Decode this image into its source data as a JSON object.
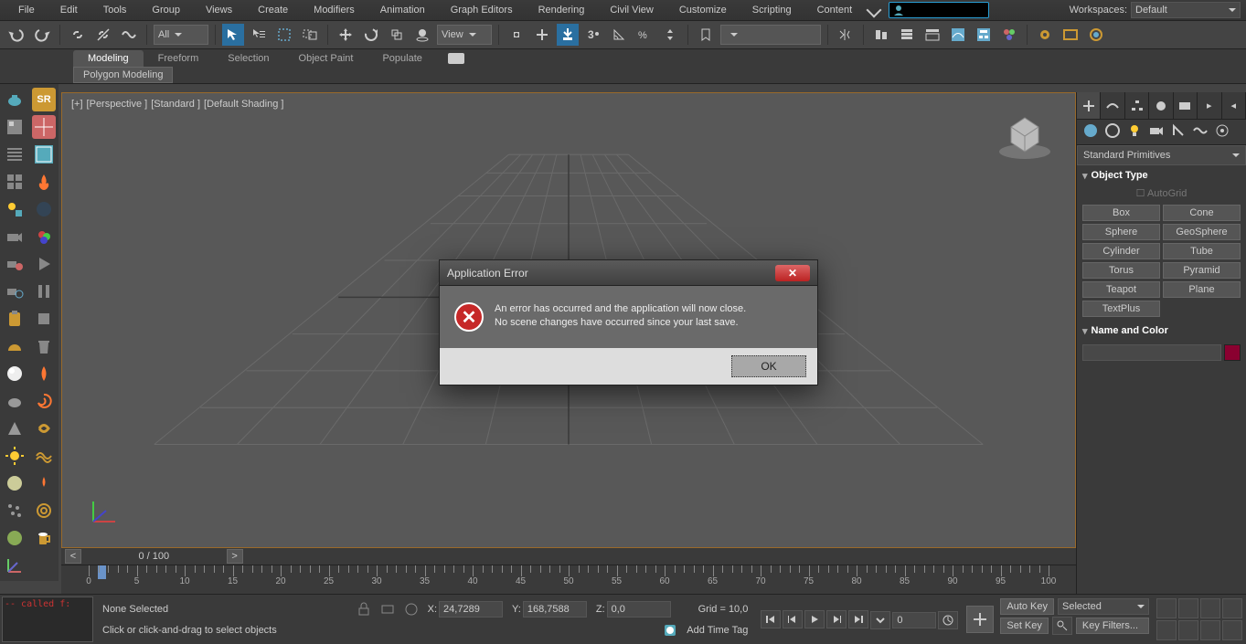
{
  "menu": [
    "File",
    "Edit",
    "Tools",
    "Group",
    "Views",
    "Create",
    "Modifiers",
    "Animation",
    "Graph Editors",
    "Rendering",
    "Civil View",
    "Customize",
    "Scripting",
    "Content"
  ],
  "workspaces": {
    "label": "Workspaces:",
    "value": "Default"
  },
  "toolbar": {
    "drop1": "All",
    "drop2": "View"
  },
  "ribbon": {
    "tabs": [
      "Modeling",
      "Freeform",
      "Selection",
      "Object Paint",
      "Populate"
    ],
    "sub": "Polygon Modeling"
  },
  "left_sr": "SR",
  "viewport": {
    "labels": [
      "[+]",
      "[Perspective ]",
      "[Standard ]",
      "[Default Shading ]"
    ]
  },
  "rpanel": {
    "category": "Standard Primitives",
    "rollouts": {
      "objtype": "Object Type",
      "namecolor": "Name and Color",
      "autogrid": "AutoGrid"
    },
    "objs": [
      [
        "Box",
        "Cone"
      ],
      [
        "Sphere",
        "GeoSphere"
      ],
      [
        "Cylinder",
        "Tube"
      ],
      [
        "Torus",
        "Pyramid"
      ],
      [
        "Teapot",
        "Plane"
      ]
    ],
    "objs_single": "TextPlus"
  },
  "timeline": {
    "pos": "0 / 100",
    "ticks": [
      0,
      5,
      10,
      15,
      20,
      25,
      30,
      35,
      40,
      45,
      50,
      55,
      60,
      65,
      70,
      75,
      80,
      85,
      90,
      95,
      100
    ]
  },
  "status": {
    "sel": "None Selected",
    "hint": "Click or click-and-drag to select objects",
    "x_label": "X:",
    "x": "24,7289",
    "y_label": "Y:",
    "y": "168,7588",
    "z_label": "Z:",
    "z": "0,0",
    "grid": "Grid = 10,0",
    "addtag": "Add Time Tag",
    "frame": "0",
    "autokey": "Auto Key",
    "setkey": "Set Key",
    "selected": "Selected",
    "keyfilters": "Key Filters...",
    "script": "-- called f:"
  },
  "modal": {
    "title": "Application Error",
    "line1": "An error has occurred and the application will now close.",
    "line2": "No scene changes have occurred since your last save.",
    "ok": "OK"
  }
}
